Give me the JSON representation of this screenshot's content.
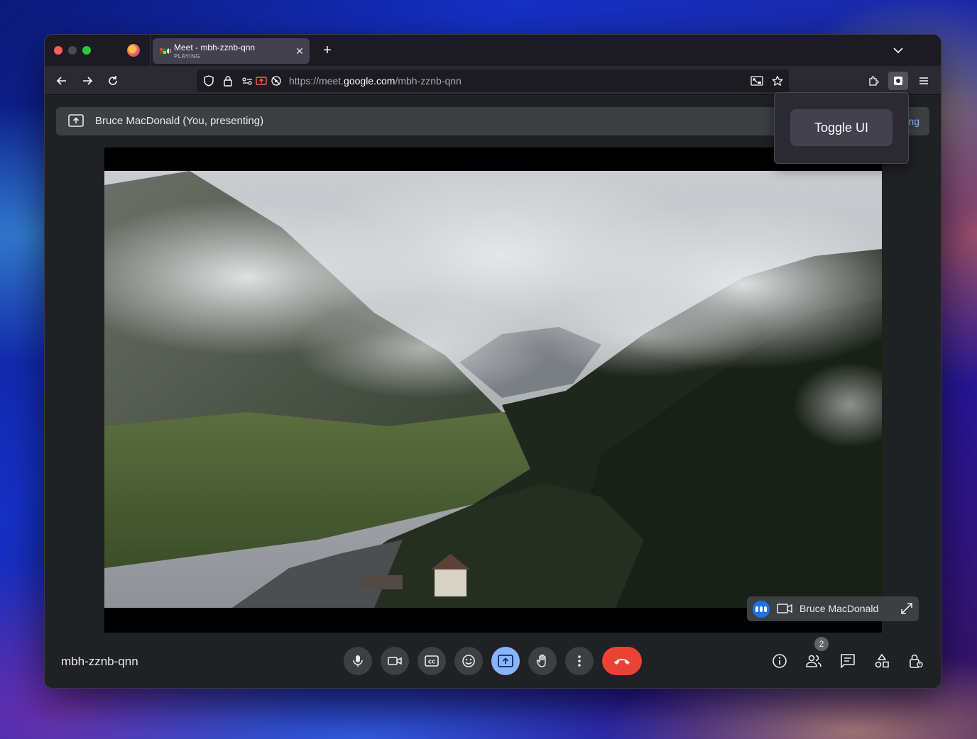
{
  "browser": {
    "tab": {
      "title": "Meet - mbh-zznb-qnn",
      "status": "PLAYING",
      "close_icon": "close-icon"
    },
    "new_tab_label": "+",
    "url": {
      "prefix": "https://meet.",
      "domain": "google.com",
      "path": "/mbh-zznb-qnn"
    }
  },
  "meet": {
    "presenting_label": "Bruce MacDonald (You, presenting)",
    "partial_button": "ng",
    "pip_name": "Bruce MacDonald",
    "meeting_code": "mbh-zznb-qnn",
    "participants_count": "2"
  },
  "popup": {
    "toggle_label": "Toggle UI"
  },
  "colors": {
    "end_call": "#ea4335",
    "present_active": "#8ab4f8",
    "accent_blue": "#1a73e8"
  }
}
